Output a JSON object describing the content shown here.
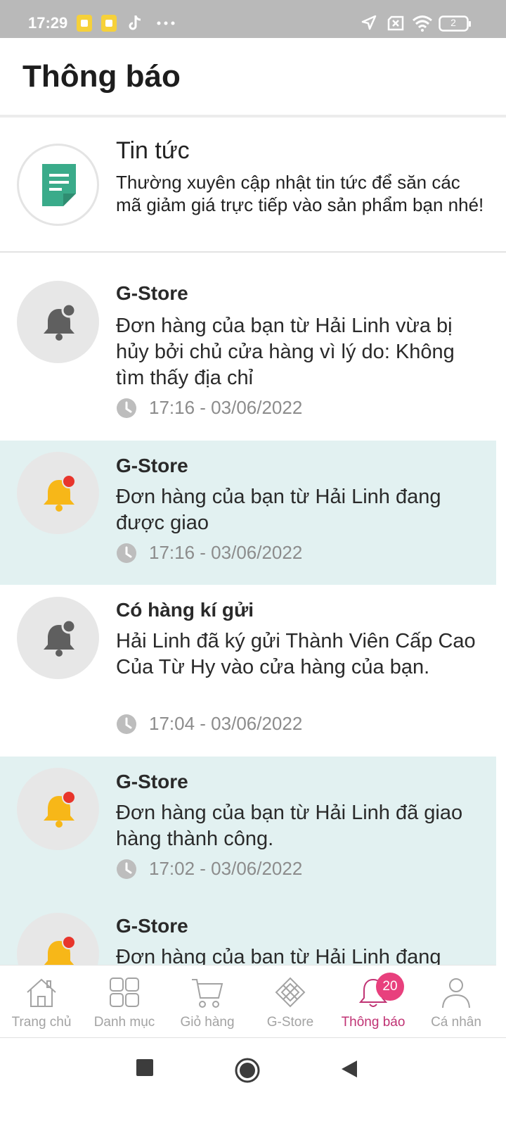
{
  "status_bar": {
    "time": "17:29",
    "battery_level": "2",
    "icons": [
      "app-notification-icon",
      "app-notification-icon",
      "tiktok-icon",
      "more-dots-icon",
      "location-arrow-icon",
      "sim-x-icon",
      "wifi-icon",
      "battery-icon"
    ]
  },
  "header": {
    "title": "Thông báo"
  },
  "news": {
    "icon": "document-icon",
    "title": "Tin tức",
    "description": "Thường xuyên cập nhật tin tức để săn các mã giảm giá trực tiếp vào sản phẩm bạn nhé!"
  },
  "colors": {
    "accent": "#c03374",
    "badge": "#e8407d",
    "unread_background": "#e2f1f1",
    "news_icon": "#3aab8a",
    "unread_bell": "#f7b718",
    "unread_dot": "#e8352c"
  },
  "notifications": [
    {
      "title": "G-Store",
      "body": "Đơn hàng của bạn từ Hải Linh vừa bị hủy bởi chủ cửa hàng vì lý do: Không tìm thấy địa chỉ",
      "time": "17:16 - 03/06/2022",
      "unread": false
    },
    {
      "title": "G-Store",
      "body": "Đơn hàng của bạn từ Hải Linh đang được giao",
      "time": "17:16 - 03/06/2022",
      "unread": true
    },
    {
      "title": "Có hàng kí gửi",
      "body": "Hải Linh đã ký gửi Thành Viên Cấp Cao Của Từ Hy vào cửa hàng của bạn.",
      "time": "17:04 - 03/06/2022",
      "unread": false
    },
    {
      "title": "G-Store",
      "body": "Đơn hàng của bạn từ Hải Linh đã giao hàng thành công.",
      "time": "17:02 - 03/06/2022",
      "unread": true
    },
    {
      "title": "G-Store",
      "body": "Đơn hàng của bạn từ Hải Linh đang",
      "unread": true
    }
  ],
  "bottom_nav": {
    "items": [
      {
        "label": "Trang chủ",
        "icon": "home-icon"
      },
      {
        "label": "Danh mục",
        "icon": "grid-icon"
      },
      {
        "label": "Giỏ hàng",
        "icon": "cart-icon"
      },
      {
        "label": "G-Store",
        "icon": "gstore-logo-icon"
      },
      {
        "label": "Thông báo",
        "icon": "bell-icon",
        "active": true,
        "badge": "20"
      },
      {
        "label": "Cá nhân",
        "icon": "person-icon"
      }
    ]
  },
  "system_nav": {
    "buttons": [
      "recent-apps-icon",
      "home-circle-icon",
      "back-triangle-icon"
    ]
  }
}
